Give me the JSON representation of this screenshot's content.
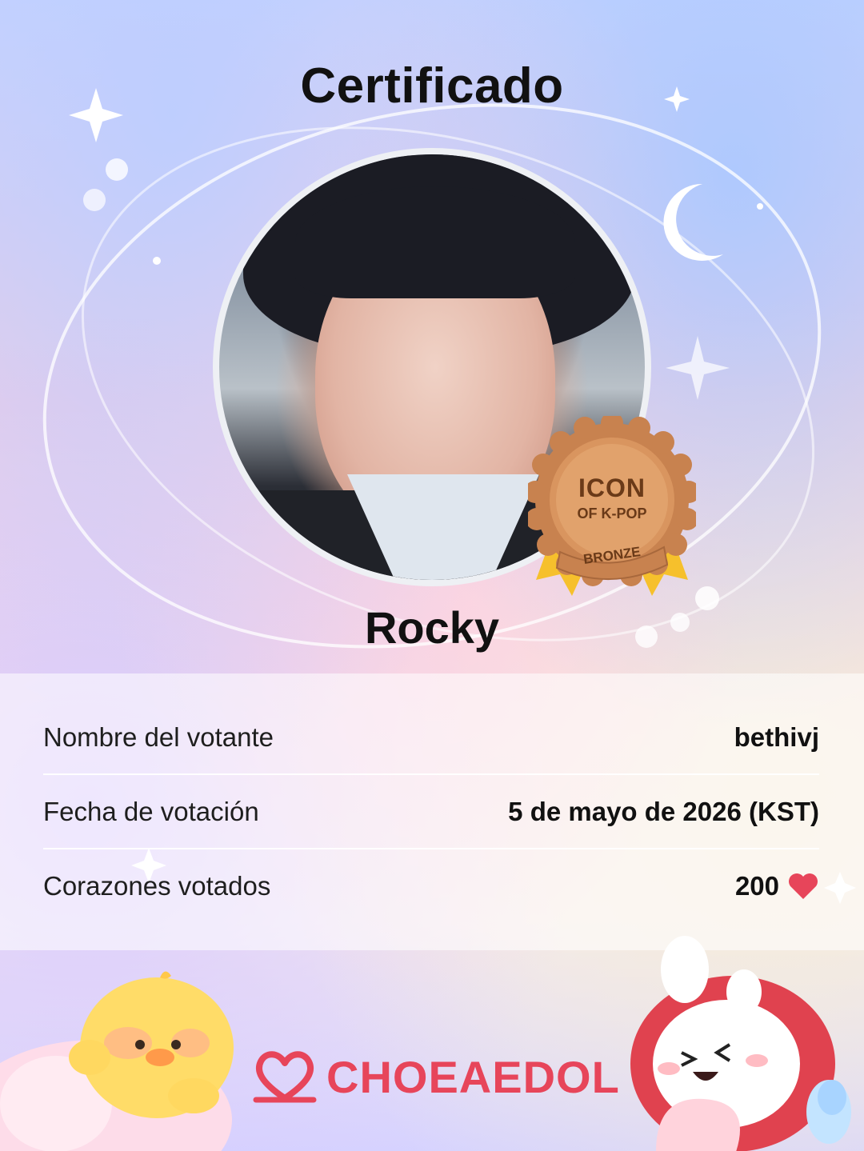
{
  "certificate": {
    "title": "Certificado",
    "idol_name": "Rocky"
  },
  "badge": {
    "line1": "ICON",
    "line2": "OF K-POP",
    "tier": "BRONZE",
    "color": "#c8824f"
  },
  "details": {
    "voter_label": "Nombre del votante",
    "voter_value": "bethivj",
    "date_label": "Fecha de votación",
    "date_value": "5 de mayo de 2026 (KST)",
    "hearts_label": "Corazones votados",
    "hearts_value": "200",
    "heart_icon": "heart-icon"
  },
  "brand": {
    "name": "CHOEAEDOL",
    "color": "#e7455a"
  }
}
